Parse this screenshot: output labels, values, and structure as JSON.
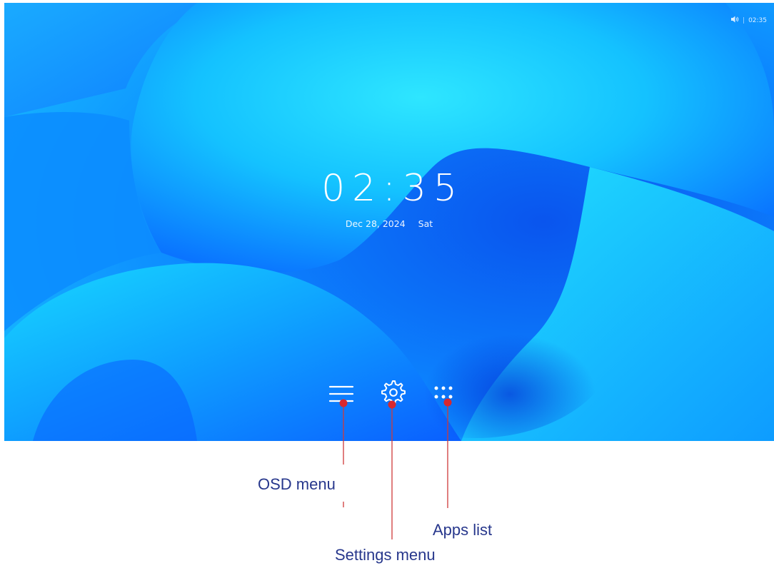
{
  "status_bar": {
    "volume_icon": "speaker-icon",
    "time": "02:35"
  },
  "home": {
    "clock": "02:35",
    "date": "Dec 28, 2024",
    "weekday": "Sat"
  },
  "dock": [
    {
      "id": "osd",
      "icon": "hamburger-menu-icon"
    },
    {
      "id": "settings",
      "icon": "gear-icon"
    },
    {
      "id": "apps",
      "icon": "apps-grid-icon"
    }
  ],
  "callouts": {
    "osd_menu": "OSD menu",
    "settings_menu": "Settings menu",
    "apps_list": "Apps list",
    "line_color": "#d03a3a"
  },
  "colors": {
    "wallpaper_deep": "#0a6cff",
    "wallpaper_light": "#19e3ff",
    "label_text": "#27378c"
  }
}
